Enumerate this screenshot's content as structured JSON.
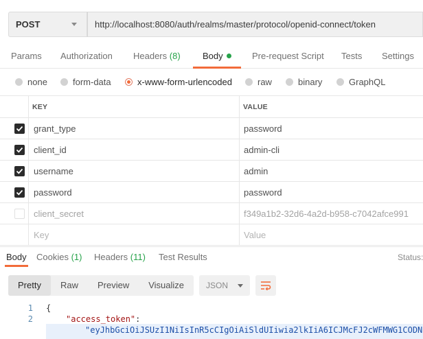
{
  "request": {
    "method": "POST",
    "url": "http://localhost:8080/auth/realms/master/protocol/openid-connect/token"
  },
  "request_tabs": {
    "params": "Params",
    "authorization": "Authorization",
    "headers": "Headers",
    "headers_count": "(8)",
    "body": "Body",
    "pre_request": "Pre-request Script",
    "tests": "Tests",
    "settings": "Settings"
  },
  "body_types": {
    "none": "none",
    "form_data": "form-data",
    "urlencoded": "x-www-form-urlencoded",
    "raw": "raw",
    "binary": "binary",
    "graphql": "GraphQL",
    "selected": "x-www-form-urlencoded"
  },
  "params_table": {
    "key_header": "KEY",
    "value_header": "VALUE",
    "rows": [
      {
        "key": "grant_type",
        "value": "password",
        "checked": true
      },
      {
        "key": "client_id",
        "value": "admin-cli",
        "checked": true
      },
      {
        "key": "username",
        "value": "admin",
        "checked": true
      },
      {
        "key": "password",
        "value": "password",
        "checked": true
      },
      {
        "key": "client_secret",
        "value": "f349a1b2-32d6-4a2d-b958-c7042afce991",
        "checked": false
      }
    ],
    "key_placeholder": "Key",
    "value_placeholder": "Value"
  },
  "response_tabs": {
    "body": "Body",
    "cookies": "Cookies",
    "cookies_count": "(1)",
    "headers": "Headers",
    "headers_count": "(11)",
    "test_results": "Test Results",
    "status_label": "Status:"
  },
  "view_toolbar": {
    "pretty": "Pretty",
    "raw": "Raw",
    "preview": "Preview",
    "visualize": "Visualize",
    "format": "JSON",
    "wrap_icon": "wrap-lines-icon"
  },
  "code": {
    "line1_no": "1",
    "line2_no": "2",
    "line1": "{",
    "line2_key": "\"access_token\"",
    "line2_colon": ":",
    "line3": "\"eyJhbGciOiJSUzI1NiIsInR5cCIgOiAiSldUIiwia2lkIiA6ICJMcFJ2cWFMWG1CODN"
  },
  "colors": {
    "accent": "#f26b3a",
    "count_green": "#27a34a"
  }
}
